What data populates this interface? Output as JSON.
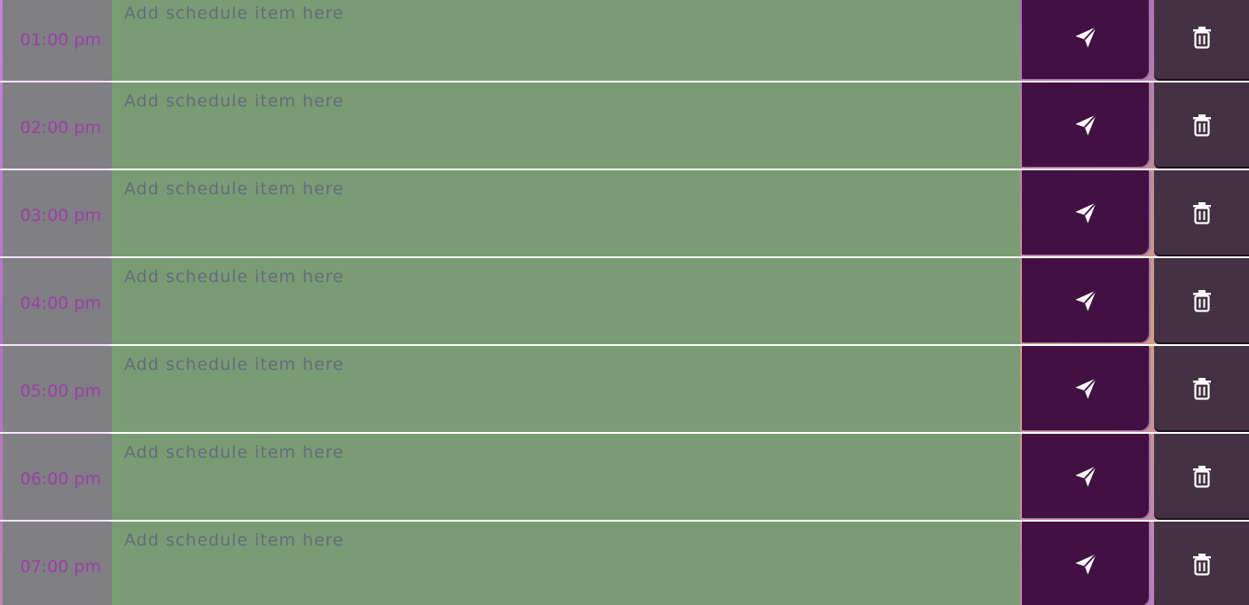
{
  "schedule": {
    "placeholder": "Add schedule item here",
    "rows": [
      {
        "hour": "01:00 pm"
      },
      {
        "hour": "02:00 pm"
      },
      {
        "hour": "03:00 pm"
      },
      {
        "hour": "04:00 pm"
      },
      {
        "hour": "05:00 pm"
      },
      {
        "hour": "06:00 pm"
      },
      {
        "hour": "07:00 pm"
      }
    ]
  },
  "icons": {
    "save": "paper-plane-icon",
    "delete": "trash-icon"
  },
  "colors": {
    "hour_bg": "#807f84",
    "hour_text": "#9b3fa7",
    "task_bg": "#7a9c75",
    "save_bg": "#421042",
    "delete_bg": "#443144"
  }
}
